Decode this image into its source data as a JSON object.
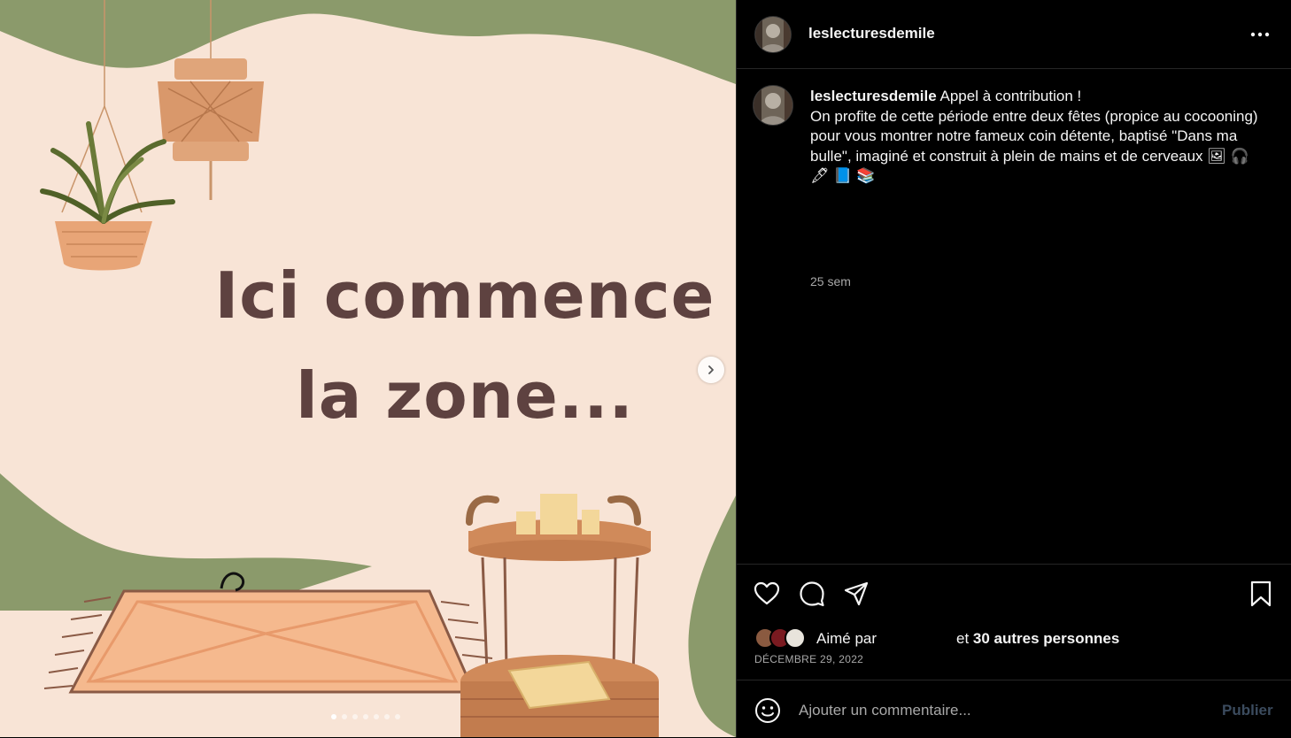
{
  "post": {
    "slide": {
      "line1": "Ici commence",
      "line2": "la zone...",
      "dots_total": 7,
      "dots_active": 0,
      "colors": {
        "background": "#f8e4d6",
        "green": "#8b9a6b",
        "text": "#5e4240"
      }
    },
    "header": {
      "username": "leslecturesdemile",
      "more_icon": "more-horizontal-icon"
    },
    "caption": {
      "username": "leslecturesdemile",
      "text_first": "Appel à contribution !",
      "text_body": "On profite de cette période entre deux fêtes (propice au cocooning) pour vous montrer notre fameux coin détente, baptisé \"Dans ma bulle\", imaginé et construit à plein de mains et de cerveaux 🖼 🎧 🖋 📘 📚",
      "time": "25 sem"
    },
    "actions": {
      "like_icon": "heart-icon",
      "comment_icon": "comment-icon",
      "share_icon": "paper-plane-icon",
      "save_icon": "bookmark-icon"
    },
    "likes": {
      "prefix": "Aimé par",
      "others": "30 autres personnes",
      "connector": "et"
    },
    "date": "DÉCEMBRE 29, 2022",
    "comment": {
      "placeholder": "Ajouter un commentaire...",
      "publish": "Publier",
      "emoji_icon": "smiley-icon"
    }
  }
}
